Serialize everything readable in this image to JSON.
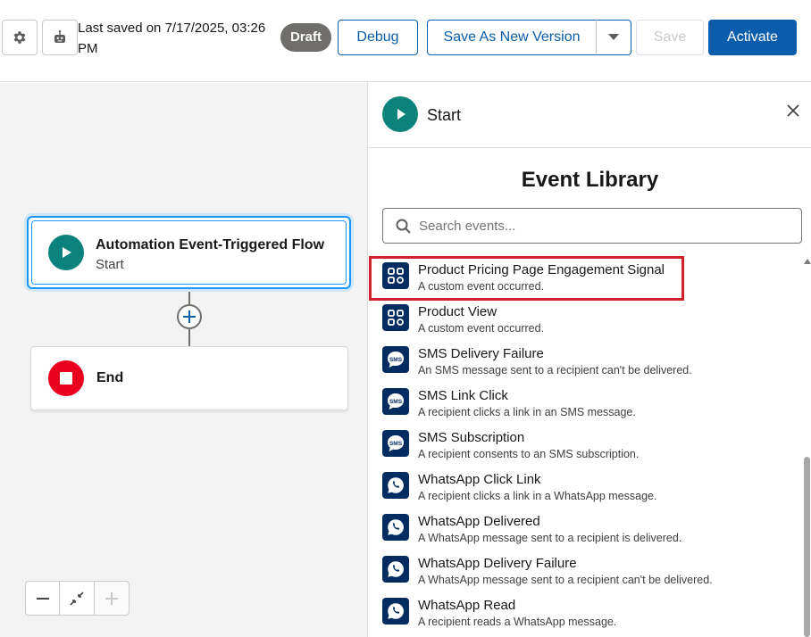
{
  "toolbar": {
    "settings_icon": "gear-icon",
    "runtime_icon": "robot-icon",
    "saved_text": "Last saved on 7/17/2025, 03:26 PM",
    "status_badge": "Draft",
    "debug_label": "Debug",
    "save_new_version_label": "Save As New Version",
    "save_label": "Save",
    "activate_label": "Activate",
    "brand_color": "#0b5cab"
  },
  "canvas": {
    "start_node": {
      "title": "Automation Event-Triggered Flow",
      "subtitle": "Start",
      "icon": "play-icon",
      "icon_color": "#0b827c"
    },
    "end_node": {
      "title": "End",
      "icon": "stop-icon",
      "icon_color": "#ea001e"
    },
    "zoom": {
      "zoom_out_icon": "minus-icon",
      "fit_icon": "collapse-icon",
      "zoom_in_icon": "plus-icon"
    }
  },
  "panel": {
    "header_title": "Start",
    "header_icon": "play-icon",
    "library_title": "Event Library",
    "search": {
      "placeholder": "Search events..."
    },
    "events": [
      {
        "name": "Product Pricing Page Engagement Signal",
        "description": "A custom event occurred.",
        "icon": "custom-event-icon",
        "highlighted": true
      },
      {
        "name": "Product View",
        "description": "A custom event occurred.",
        "icon": "custom-event-icon"
      },
      {
        "name": "SMS Delivery Failure",
        "description": "An SMS message sent to a recipient can't be delivered.",
        "icon": "sms-icon"
      },
      {
        "name": "SMS Link Click",
        "description": "A recipient clicks a link in an SMS message.",
        "icon": "sms-icon"
      },
      {
        "name": "SMS Subscription",
        "description": "A recipient consents to an SMS subscription.",
        "icon": "sms-icon"
      },
      {
        "name": "WhatsApp Click Link",
        "description": "A recipient clicks a link in a WhatsApp message.",
        "icon": "whatsapp-icon"
      },
      {
        "name": "WhatsApp Delivered",
        "description": "A WhatsApp message sent to a recipient is delivered.",
        "icon": "whatsapp-icon"
      },
      {
        "name": "WhatsApp Delivery Failure",
        "description": "A WhatsApp message sent to a recipient can't be delivered.",
        "icon": "whatsapp-icon"
      },
      {
        "name": "WhatsApp Read",
        "description": "A recipient reads a WhatsApp message.",
        "icon": "whatsapp-icon"
      }
    ]
  }
}
